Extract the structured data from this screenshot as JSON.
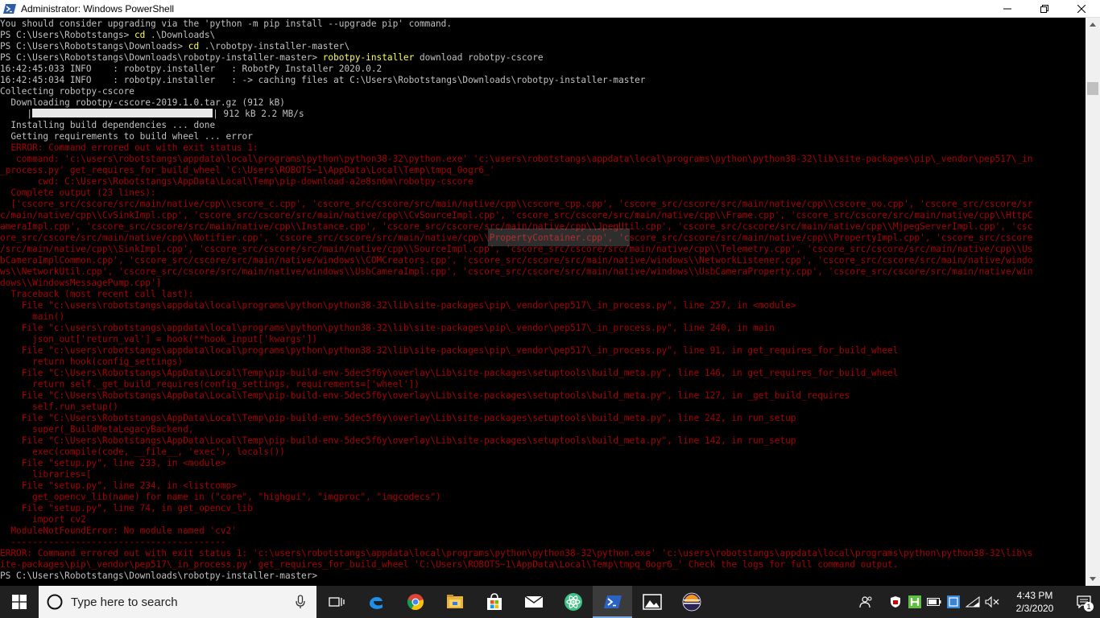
{
  "window": {
    "title": "Administrator: Windows PowerShell",
    "controls": {
      "minimize": "minimize",
      "maximize": "maximize",
      "close": "close"
    }
  },
  "console": {
    "lines": [
      {
        "text": "You should consider upgrading via the 'python -m pip install --upgrade pip' command."
      },
      {
        "prompt": "PS C:\\Users\\Robotstangs> ",
        "command": "cd",
        "args": " .\\Downloads\\"
      },
      {
        "prompt": "PS C:\\Users\\Robotstangs\\Downloads> ",
        "command": "cd",
        "args": " .\\robotpy-installer-master\\"
      },
      {
        "prompt": "PS C:\\Users\\Robotstangs\\Downloads\\robotpy-installer-master> ",
        "command": "robotpy-installer",
        "args": " download robotpy-cscore"
      },
      {
        "text": "16:42:45:033 INFO    : robotpy.installer   : RobotPy Installer 2020.0.2"
      },
      {
        "text": "16:42:45:034 INFO    : robotpy.installer   : -> caching files at C:\\Users\\Robotstangs\\Downloads\\robotpy-installer-master"
      },
      {
        "text": "Collecting robotpy-cscore"
      },
      {
        "text": "  Downloading robotpy-cscore-2019.1.0.tar.gz (912 kB)"
      },
      {
        "progress_pre": "     |",
        "progress_post": "| 912 kB 2.2 MB/s"
      },
      {
        "text": "  Installing build dependencies ... done"
      },
      {
        "text": "  Getting requirements to build wheel ... error"
      },
      {
        "text": "  ERROR: Command errored out with exit status 1:",
        "error": true
      },
      {
        "text": "   command: 'c:\\users\\robotstangs\\appdata\\local\\programs\\python\\python38-32\\python.exe' 'c:\\users\\robotstangs\\appdata\\local\\programs\\python\\python38-32\\lib\\site-packages\\pip\\_vendor\\pep517\\_in",
        "error": true
      },
      {
        "text": "_process.py' get_requires_for_build_wheel 'C:\\Users\\ROBOTS~1\\AppData\\Local\\Temp\\tmpq_0ogr6_'",
        "error": true
      },
      {
        "text": "       cwd: C:\\Users\\Robotstangs\\AppData\\Local\\Temp\\pip-download-a2e8sn6m\\robotpy-cscore",
        "error": true
      },
      {
        "text": "  Complete output (23 lines):",
        "error": true
      },
      {
        "text": "  ['cscore_src/cscore/src/main/native/cpp\\\\cscore_c.cpp', 'cscore_src/cscore/src/main/native/cpp\\\\cscore_cpp.cpp', 'cscore_src/cscore/src/main/native/cpp\\\\cscore_oo.cpp', 'cscore_src/cscore/sr",
        "error": true
      },
      {
        "text": "c/main/native/cpp\\\\CvSinkImpl.cpp', 'cscore_src/cscore/src/main/native/cpp\\\\CvSourceImpl.cpp', 'cscore_src/cscore/src/main/native/cpp\\\\Frame.cpp', 'cscore_src/cscore/src/main/native/cpp\\\\HttpC",
        "error": true
      },
      {
        "text": "ameraImpl.cpp', 'cscore_src/cscore/src/main/native/cpp\\\\Instance.cpp', 'cscore_src/cscore/src/main/native/cpp\\\\JpegUtil.cpp', 'cscore_src/cscore/src/main/native/cpp\\\\MjpegServerImpl.cpp', 'csc",
        "error": true
      },
      {
        "text": "ore_src/cscore/src/main/native/cpp\\\\Notifier.cpp', 'cscore_src/cscore/src/main/native/cpp\\\\PropertyContainer.cpp', 'cscore_src/cscore/src/main/native/cpp\\\\PropertyImpl.cpp', 'cscore_src/cscore",
        "error": true
      },
      {
        "text": "/src/main/native/cpp\\\\SinkImpl.cpp', 'cscore_src/cscore/src/main/native/cpp\\\\SourceImpl.cpp', 'cscore_src/cscore/src/main/native/cpp\\\\Telemetry.cpp', 'cscore_src/cscore/src/main/native/cpp\\\\Us",
        "error": true
      },
      {
        "text": "bCameraImplCommon.cpp', 'cscore_src/cscore/src/main/native/windows\\\\COMCreators.cpp', 'cscore_src/cscore/src/main/native/windows\\\\NetworkListener.cpp', 'cscore_src/cscore/src/main/native/windo",
        "error": true
      },
      {
        "text": "ws\\\\NetworkUtil.cpp', 'cscore_src/cscore/src/main/native/windows\\\\UsbCameraImpl.cpp', 'cscore_src/cscore/src/main/native/windows\\\\UsbCameraProperty.cpp', 'cscore_src/cscore/src/main/native/win",
        "error": true
      },
      {
        "text": "dows\\\\WindowsMessagePump.cpp']",
        "error": true
      },
      {
        "text": "  Traceback (most recent call last):",
        "error": true
      },
      {
        "text": "    File \"c:\\users\\robotstangs\\appdata\\local\\programs\\python\\python38-32\\lib\\site-packages\\pip\\_vendor\\pep517\\_in_process.py\", line 257, in <module>",
        "error": true
      },
      {
        "text": "      main()",
        "error": true
      },
      {
        "text": "    File \"c:\\users\\robotstangs\\appdata\\local\\programs\\python\\python38-32\\lib\\site-packages\\pip\\_vendor\\pep517\\_in_process.py\", line 240, in main",
        "error": true
      },
      {
        "text": "      json_out['return_val'] = hook(**hook_input['kwargs'])",
        "error": true
      },
      {
        "text": "    File \"c:\\users\\robotstangs\\appdata\\local\\programs\\python\\python38-32\\lib\\site-packages\\pip\\_vendor\\pep517\\_in_process.py\", line 91, in get_requires_for_build_wheel",
        "error": true
      },
      {
        "text": "      return hook(config_settings)",
        "error": true
      },
      {
        "text": "    File \"C:\\Users\\Robotstangs\\AppData\\Local\\Temp\\pip-build-env-5dec5f6y\\overlay\\Lib\\site-packages\\setuptools\\build_meta.py\", line 146, in get_requires_for_build_wheel",
        "error": true
      },
      {
        "text": "      return self._get_build_requires(config_settings, requirements=['wheel'])",
        "error": true
      },
      {
        "text": "    File \"C:\\Users\\Robotstangs\\AppData\\Local\\Temp\\pip-build-env-5dec5f6y\\overlay\\Lib\\site-packages\\setuptools\\build_meta.py\", line 127, in _get_build_requires",
        "error": true
      },
      {
        "text": "      self.run_setup()",
        "error": true
      },
      {
        "text": "    File \"C:\\Users\\Robotstangs\\AppData\\Local\\Temp\\pip-build-env-5dec5f6y\\overlay\\Lib\\site-packages\\setuptools\\build_meta.py\", line 242, in run_setup",
        "error": true
      },
      {
        "text": "      super(_BuildMetaLegacyBackend,",
        "error": true
      },
      {
        "text": "    File \"C:\\Users\\Robotstangs\\AppData\\Local\\Temp\\pip-build-env-5dec5f6y\\overlay\\Lib\\site-packages\\setuptools\\build_meta.py\", line 142, in run_setup",
        "error": true
      },
      {
        "text": "      exec(compile(code, __file__, 'exec'), locals())",
        "error": true
      },
      {
        "text": "    File \"setup.py\", line 233, in <module>",
        "error": true
      },
      {
        "text": "      libraries=[",
        "error": true
      },
      {
        "text": "    File \"setup.py\", line 234, in <listcomp>",
        "error": true
      },
      {
        "text": "      get_opencv_lib(name) for name in (\"core\", \"highgui\", \"imgproc\", \"imgcodecs\")",
        "error": true
      },
      {
        "text": "    File \"setup.py\", line 74, in get_opencv_lib",
        "error": true
      },
      {
        "text": "      import cv2",
        "error": true
      },
      {
        "text": "  ModuleNotFoundError: No module named 'cv2'",
        "error": true
      },
      {
        "text": "  ----------------------------------------",
        "error": true
      },
      {
        "text": "ERROR: Command errored out with exit status 1: 'c:\\users\\robotstangs\\appdata\\local\\programs\\python\\python38-32\\python.exe' 'c:\\users\\robotstangs\\appdata\\local\\programs\\python\\python38-32\\lib\\s",
        "error": true
      },
      {
        "text": "ite-packages\\pip\\_vendor\\pep517\\_in_process.py' get_requires_for_build_wheel 'C:\\Users\\ROBOTS~1\\AppData\\Local\\Temp\\tmpq_0ogr6_' Check the logs for full command output.",
        "error": true
      },
      {
        "text": "PS C:\\Users\\Robotstangs\\Downloads\\robotpy-installer-master>"
      }
    ]
  },
  "taskbar": {
    "search_placeholder": "Type here to search",
    "apps": [
      {
        "name": "task-view-icon"
      },
      {
        "name": "edge-icon"
      },
      {
        "name": "chrome-icon"
      },
      {
        "name": "file-explorer-icon"
      },
      {
        "name": "store-icon"
      },
      {
        "name": "mail-icon"
      },
      {
        "name": "atom-icon"
      },
      {
        "name": "powershell-icon",
        "active": true
      },
      {
        "name": "photos-icon"
      },
      {
        "name": "eclipse-icon"
      }
    ],
    "tray": {
      "time": "4:43 PM",
      "date": "2/3/2020",
      "notification_count": "1"
    }
  },
  "colors": {
    "console_bg": "#000000",
    "console_text": "#c0c0c0",
    "error_text": "#a50000",
    "command_text": "#ffff55",
    "taskbar_bg": "#202020"
  }
}
